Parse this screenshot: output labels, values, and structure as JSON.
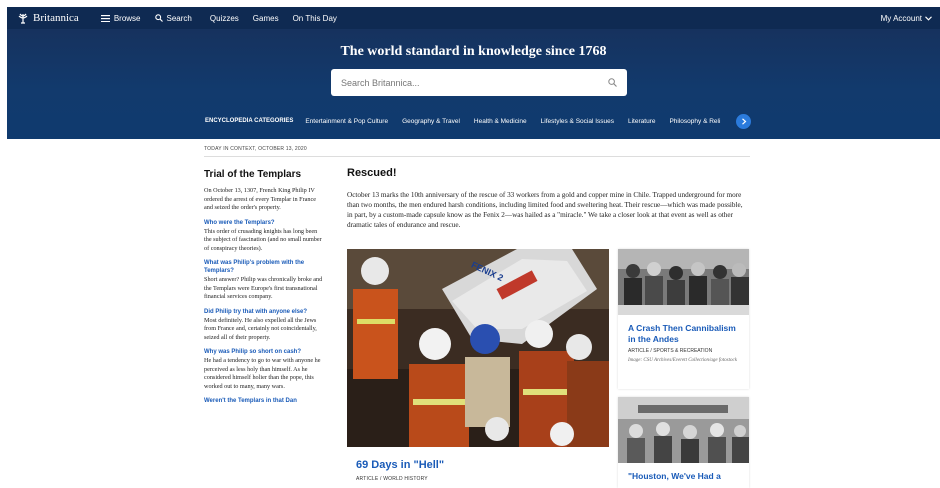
{
  "nav": {
    "logo_text": "Britannica",
    "browse": "Browse",
    "search": "Search",
    "quizzes": "Quizzes",
    "games": "Games",
    "on_this_day": "On This Day",
    "account": "My Account"
  },
  "hero": {
    "tagline": "The world standard in knowledge since 1768",
    "search_placeholder": "Search Britannica..."
  },
  "categories": {
    "label": "ENCYCLOPEDIA CATEGORIES",
    "items": [
      "Entertainment & Pop Culture",
      "Geography & Travel",
      "Health & Medicine",
      "Lifestyles & Social Issues",
      "Literature",
      "Philosophy & Reli"
    ]
  },
  "left": {
    "dateline": "TODAY IN CONTEXT, OCTOBER 13, 2020",
    "title": "Trial of the Templars",
    "intro": "On October 13, 1307, French King Philip IV ordered the arrest of every Templar in France and seized the order's property.",
    "qa": [
      {
        "q": "Who were the Templars?",
        "a": "This order of crusading knights has long been the subject of fascination (and no small number of conspiracy theories)."
      },
      {
        "q": "What was Philip's problem with the Templars?",
        "a": "Short answer? Philip was chronically broke and the Templars were Europe's first transnational financial services company."
      },
      {
        "q": "Did Philip try that with anyone else?",
        "a": "Most definitely. He also expelled all the Jews from France and, certainly not coincidentally, seized all of their property."
      },
      {
        "q": "Why was Philip so short on cash?",
        "a": "He had a tendency to go to war with anyone he perceived as less holy than himself. As he considered himself holier than the pope, this worked out to many, many wars."
      },
      {
        "q": "Weren't the Templars in that Dan",
        "a": ""
      }
    ]
  },
  "main": {
    "title": "Rescued!",
    "body": "October 13 marks the 10th anniversary of the rescue of 33 workers from a gold and copper mine in Chile. Trapped underground for more than two months, the men endured harsh conditions, including limited food and sweltering heat. Their rescue—which was made possible, in part, by a custom-made capsule know as the Fenix 2—was hailed as a \"miracle.\" We take a closer look at that event as well as other dramatic tales of endurance and rescue.",
    "feature": {
      "title": "69 Days in \"Hell\"",
      "type": "ARTICLE / WORLD HISTORY",
      "capsule_text": "FENIX 2"
    },
    "card1": {
      "title": "A Crash Then Cannibalism in the Andes",
      "type": "ARTICLE / SPORTS & RECREATION",
      "credit": "Image: CSU Archives/Everett Collection/age fotostock"
    },
    "card2": {
      "title": "\"Houston, We've Had a"
    }
  }
}
